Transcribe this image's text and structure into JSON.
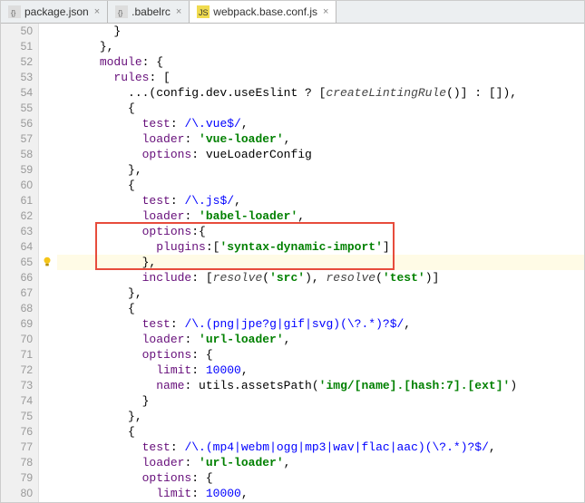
{
  "tabs": [
    {
      "label": "package.json",
      "icon": "json",
      "active": false
    },
    {
      "label": ".babelrc",
      "icon": "json",
      "active": false
    },
    {
      "label": "webpack.base.conf.js",
      "icon": "js",
      "active": true
    }
  ],
  "line_start": 50,
  "line_end": 80,
  "current_line": 65,
  "code_lines": [
    {
      "n": 50,
      "indent": 4,
      "tokens": [
        {
          "t": "}",
          "c": ""
        }
      ]
    },
    {
      "n": 51,
      "indent": 3,
      "tokens": [
        {
          "t": "},",
          "c": ""
        }
      ]
    },
    {
      "n": 52,
      "indent": 3,
      "tokens": [
        {
          "t": "module",
          "c": "prop"
        },
        {
          "t": ": {",
          "c": ""
        }
      ]
    },
    {
      "n": 53,
      "indent": 4,
      "tokens": [
        {
          "t": "rules",
          "c": "prop"
        },
        {
          "t": ": [",
          "c": ""
        }
      ]
    },
    {
      "n": 54,
      "indent": 5,
      "tokens": [
        {
          "t": "...(config.dev.useEslint ? [",
          "c": ""
        },
        {
          "t": "createLintingRule",
          "c": "ital"
        },
        {
          "t": "()] : []),",
          "c": ""
        }
      ]
    },
    {
      "n": 55,
      "indent": 5,
      "tokens": [
        {
          "t": "{",
          "c": ""
        }
      ]
    },
    {
      "n": 56,
      "indent": 6,
      "tokens": [
        {
          "t": "test",
          "c": "prop"
        },
        {
          "t": ": ",
          "c": ""
        },
        {
          "t": "/\\.vue$/",
          "c": "regex"
        },
        {
          "t": ",",
          "c": ""
        }
      ]
    },
    {
      "n": 57,
      "indent": 6,
      "tokens": [
        {
          "t": "loader",
          "c": "prop"
        },
        {
          "t": ": ",
          "c": ""
        },
        {
          "t": "'vue-loader'",
          "c": "str"
        },
        {
          "t": ",",
          "c": ""
        }
      ]
    },
    {
      "n": 58,
      "indent": 6,
      "tokens": [
        {
          "t": "options",
          "c": "prop"
        },
        {
          "t": ": vueLoaderConfig",
          "c": ""
        }
      ]
    },
    {
      "n": 59,
      "indent": 5,
      "tokens": [
        {
          "t": "},",
          "c": ""
        }
      ]
    },
    {
      "n": 60,
      "indent": 5,
      "tokens": [
        {
          "t": "{",
          "c": ""
        }
      ]
    },
    {
      "n": 61,
      "indent": 6,
      "tokens": [
        {
          "t": "test",
          "c": "prop"
        },
        {
          "t": ": ",
          "c": ""
        },
        {
          "t": "/\\.js$/",
          "c": "regex"
        },
        {
          "t": ",",
          "c": ""
        }
      ]
    },
    {
      "n": 62,
      "indent": 6,
      "tokens": [
        {
          "t": "loader",
          "c": "prop"
        },
        {
          "t": ": ",
          "c": ""
        },
        {
          "t": "'babel-loader'",
          "c": "str"
        },
        {
          "t": ",",
          "c": ""
        }
      ]
    },
    {
      "n": 63,
      "indent": 6,
      "tokens": [
        {
          "t": "options",
          "c": "prop"
        },
        {
          "t": ":{",
          "c": ""
        }
      ]
    },
    {
      "n": 64,
      "indent": 7,
      "tokens": [
        {
          "t": "plugins",
          "c": "prop"
        },
        {
          "t": ":[",
          "c": ""
        },
        {
          "t": "'syntax-dynamic-import'",
          "c": "str"
        },
        {
          "t": "]",
          "c": ""
        }
      ]
    },
    {
      "n": 65,
      "indent": 6,
      "tokens": [
        {
          "t": "},",
          "c": ""
        }
      ]
    },
    {
      "n": 66,
      "indent": 6,
      "tokens": [
        {
          "t": "include",
          "c": "prop"
        },
        {
          "t": ": [",
          "c": ""
        },
        {
          "t": "resolve",
          "c": "ital"
        },
        {
          "t": "(",
          "c": ""
        },
        {
          "t": "'src'",
          "c": "str"
        },
        {
          "t": "), ",
          "c": ""
        },
        {
          "t": "resolve",
          "c": "ital"
        },
        {
          "t": "(",
          "c": ""
        },
        {
          "t": "'test'",
          "c": "str"
        },
        {
          "t": ")]",
          "c": ""
        }
      ]
    },
    {
      "n": 67,
      "indent": 5,
      "tokens": [
        {
          "t": "},",
          "c": ""
        }
      ]
    },
    {
      "n": 68,
      "indent": 5,
      "tokens": [
        {
          "t": "{",
          "c": ""
        }
      ]
    },
    {
      "n": 69,
      "indent": 6,
      "tokens": [
        {
          "t": "test",
          "c": "prop"
        },
        {
          "t": ": ",
          "c": ""
        },
        {
          "t": "/\\.(png|jpe?g|gif|svg)(\\?.*)?$/",
          "c": "regex"
        },
        {
          "t": ",",
          "c": ""
        }
      ]
    },
    {
      "n": 70,
      "indent": 6,
      "tokens": [
        {
          "t": "loader",
          "c": "prop"
        },
        {
          "t": ": ",
          "c": ""
        },
        {
          "t": "'url-loader'",
          "c": "str"
        },
        {
          "t": ",",
          "c": ""
        }
      ]
    },
    {
      "n": 71,
      "indent": 6,
      "tokens": [
        {
          "t": "options",
          "c": "prop"
        },
        {
          "t": ": {",
          "c": ""
        }
      ]
    },
    {
      "n": 72,
      "indent": 7,
      "tokens": [
        {
          "t": "limit",
          "c": "prop"
        },
        {
          "t": ": ",
          "c": ""
        },
        {
          "t": "10000",
          "c": "num"
        },
        {
          "t": ",",
          "c": ""
        }
      ]
    },
    {
      "n": 73,
      "indent": 7,
      "tokens": [
        {
          "t": "name",
          "c": "prop"
        },
        {
          "t": ": utils.assetsPath(",
          "c": ""
        },
        {
          "t": "'img/[name].[hash:7].[ext]'",
          "c": "str"
        },
        {
          "t": ")",
          "c": ""
        }
      ]
    },
    {
      "n": 74,
      "indent": 6,
      "tokens": [
        {
          "t": "}",
          "c": ""
        }
      ]
    },
    {
      "n": 75,
      "indent": 5,
      "tokens": [
        {
          "t": "},",
          "c": ""
        }
      ]
    },
    {
      "n": 76,
      "indent": 5,
      "tokens": [
        {
          "t": "{",
          "c": ""
        }
      ]
    },
    {
      "n": 77,
      "indent": 6,
      "tokens": [
        {
          "t": "test",
          "c": "prop"
        },
        {
          "t": ": ",
          "c": ""
        },
        {
          "t": "/\\.(mp4|webm|ogg|mp3|wav|flac|aac)(\\?.*)?$/",
          "c": "regex"
        },
        {
          "t": ",",
          "c": ""
        }
      ]
    },
    {
      "n": 78,
      "indent": 6,
      "tokens": [
        {
          "t": "loader",
          "c": "prop"
        },
        {
          "t": ": ",
          "c": ""
        },
        {
          "t": "'url-loader'",
          "c": "str"
        },
        {
          "t": ",",
          "c": ""
        }
      ]
    },
    {
      "n": 79,
      "indent": 6,
      "tokens": [
        {
          "t": "options",
          "c": "prop"
        },
        {
          "t": ": {",
          "c": ""
        }
      ]
    },
    {
      "n": 80,
      "indent": 7,
      "tokens": [
        {
          "t": "limit",
          "c": "prop"
        },
        {
          "t": ": ",
          "c": ""
        },
        {
          "t": "10000",
          "c": "num"
        },
        {
          "t": ",",
          "c": ""
        }
      ]
    }
  ],
  "highlight_box": {
    "top_line": 63,
    "bottom_line": 65
  }
}
